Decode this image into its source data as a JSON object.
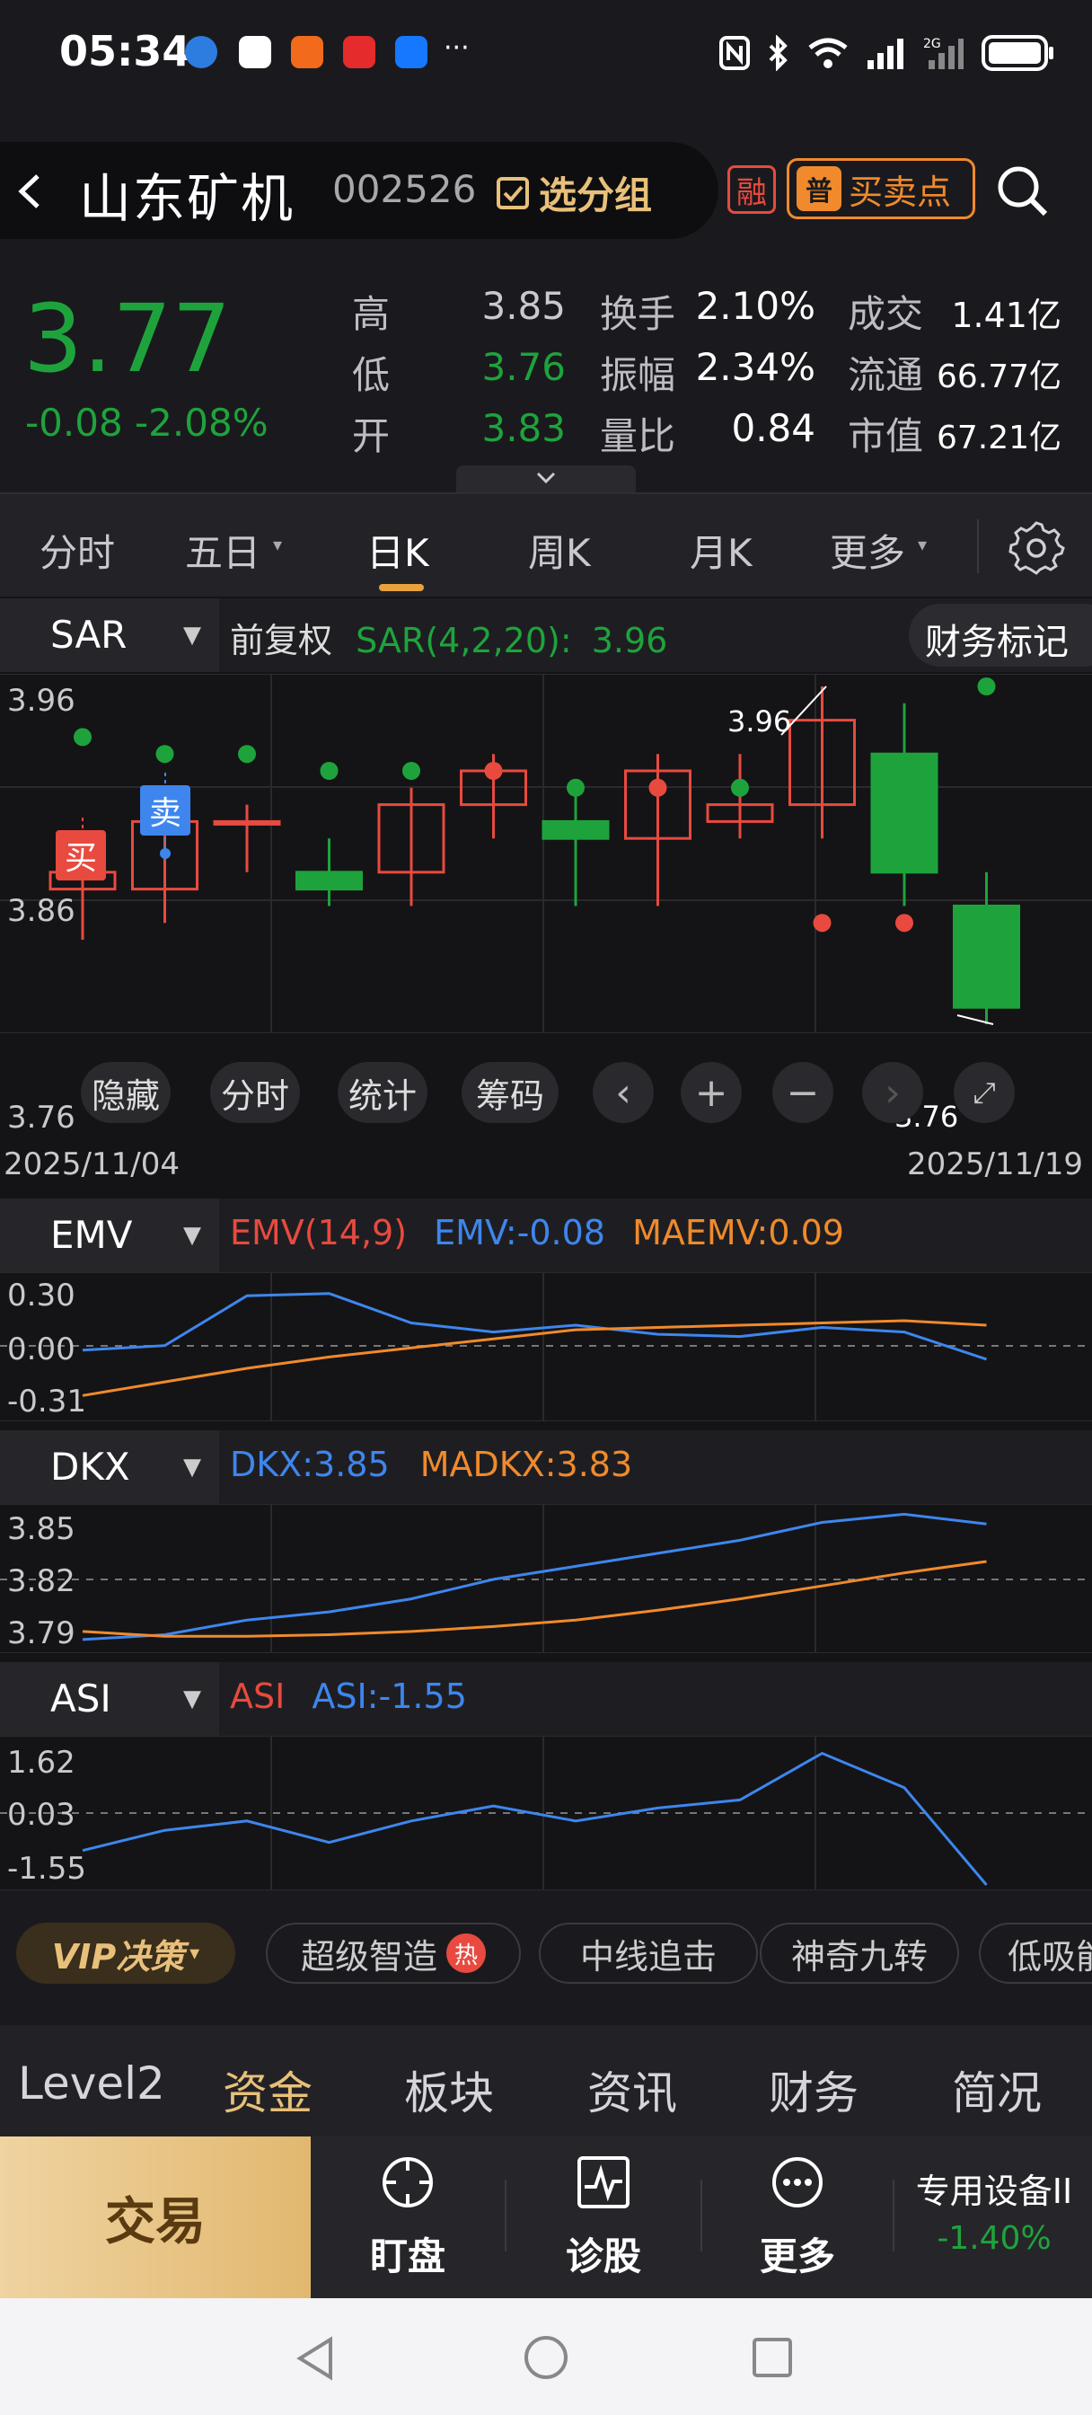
{
  "status": {
    "time": "05:34",
    "ellipsis": "···"
  },
  "header": {
    "name": "山东矿机",
    "code": "002526",
    "group_label": "选分组",
    "rong_badge": "融",
    "bs_icon": "普",
    "bs_label": "买卖点"
  },
  "quote": {
    "price": "3.77",
    "change": "-0.08  -2.08%",
    "rows": [
      {
        "l1": "高",
        "v1": "3.85",
        "l2": "换手",
        "v2": "2.10%",
        "l3": "成交",
        "v3": "1.41亿"
      },
      {
        "l1": "低",
        "v1": "3.76",
        "l2": "振幅",
        "v2": "2.34%",
        "l3": "流通",
        "v3": "66.77亿"
      },
      {
        "l1": "开",
        "v1": "3.83",
        "l2": "量比",
        "v2": "0.84",
        "l3": "市值",
        "v3": "67.21亿"
      }
    ]
  },
  "tabs": [
    "分时",
    "五日",
    "日K",
    "周K",
    "月K",
    "更多"
  ],
  "sar": {
    "selector": "SAR",
    "mode": "前复权",
    "label": "SAR(4,2,20):",
    "value": "3.96",
    "fin_mark": "财务标记",
    "y_top": "3.96",
    "y_mid": "3.86",
    "y_bot": "3.76",
    "date_start": "2025/11/04",
    "date_end": "2025/11/19",
    "high_mark": "3.96",
    "low_mark": "3.76",
    "buy": "买",
    "sell": "卖"
  },
  "tools": [
    "隐藏",
    "分时",
    "统计",
    "筹码"
  ],
  "emv": {
    "selector": "EMV",
    "label": "EMV(14,9)",
    "emv": "EMV:-0.08",
    "maemv": "MAEMV:0.09",
    "y_top": "0.30",
    "y_mid": "0.00",
    "y_bot": "-0.31"
  },
  "dkx": {
    "selector": "DKX",
    "dkx": "DKX:3.85",
    "madkx": "MADKX:3.83",
    "y_top": "3.85",
    "y_mid": "3.82",
    "y_bot": "3.79"
  },
  "asi": {
    "selector": "ASI",
    "label": "ASI",
    "asi": "ASI:-1.55",
    "y_top": "1.62",
    "y_mid": "0.03",
    "y_bot": "-1.55"
  },
  "chips": {
    "vip": "VIP决策",
    "items": [
      "超级智造",
      "中线追击",
      "神奇九转",
      "低吸能"
    ],
    "hot": "热"
  },
  "info_tabs": [
    "Level2",
    "资金",
    "板块",
    "资讯",
    "财务",
    "简况"
  ],
  "bottom": {
    "trade": "交易",
    "items": [
      "盯盘",
      "诊股",
      "更多"
    ],
    "sector_name": "专用设备II",
    "sector_change": "-1.40%"
  },
  "colors": {
    "up": "#e84a3f",
    "down": "#1ea33c",
    "blue": "#3e86ee",
    "orange": "#f08a2c",
    "gold": "#e8c07a"
  },
  "chart_data": [
    {
      "type": "candlestick",
      "title": "SAR(4,2,20)",
      "x": [
        "2025/11/04",
        "",
        "",
        "",
        "",
        "",
        "",
        "",
        "",
        "",
        "",
        "2025/11/19"
      ],
      "open": [
        3.84,
        3.84,
        3.88,
        3.85,
        3.85,
        3.89,
        3.88,
        3.87,
        3.88,
        3.89,
        3.92,
        3.83
      ],
      "close": [
        3.85,
        3.88,
        3.88,
        3.84,
        3.89,
        3.91,
        3.87,
        3.91,
        3.89,
        3.94,
        3.85,
        3.77
      ],
      "high": [
        3.86,
        3.89,
        3.89,
        3.87,
        3.9,
        3.92,
        3.9,
        3.92,
        3.92,
        3.96,
        3.95,
        3.85
      ],
      "low": [
        3.81,
        3.82,
        3.85,
        3.83,
        3.83,
        3.87,
        3.83,
        3.83,
        3.87,
        3.87,
        3.83,
        3.76
      ],
      "sar": [
        3.93,
        3.92,
        3.92,
        3.91,
        3.91,
        3.91,
        3.9,
        3.9,
        3.9,
        3.82,
        3.82,
        3.96
      ],
      "ylim": [
        3.76,
        3.96
      ]
    },
    {
      "type": "line",
      "title": "EMV(14,9)",
      "series": [
        {
          "name": "EMV",
          "values": [
            -0.02,
            0.0,
            0.22,
            0.23,
            0.1,
            0.06,
            0.09,
            0.05,
            0.04,
            0.08,
            0.06,
            -0.06
          ]
        },
        {
          "name": "MAEMV",
          "values": [
            -0.22,
            -0.16,
            -0.1,
            -0.05,
            -0.01,
            0.03,
            0.07,
            0.08,
            0.09,
            0.1,
            0.11,
            0.09
          ]
        }
      ],
      "ylim": [
        -0.31,
        0.3
      ]
    },
    {
      "type": "line",
      "title": "DKX",
      "series": [
        {
          "name": "DKX",
          "values": [
            3.785,
            3.788,
            3.797,
            3.802,
            3.81,
            3.822,
            3.83,
            3.838,
            3.846,
            3.857,
            3.862,
            3.856
          ]
        },
        {
          "name": "MADKX",
          "values": [
            3.79,
            3.787,
            3.787,
            3.788,
            3.79,
            3.793,
            3.797,
            3.803,
            3.81,
            3.818,
            3.826,
            3.833
          ]
        }
      ],
      "ylim": [
        3.78,
        3.865
      ]
    },
    {
      "type": "line",
      "title": "ASI",
      "series": [
        {
          "name": "ASI",
          "values": [
            -0.7,
            -0.2,
            0.03,
            -0.5,
            0.03,
            0.4,
            0.03,
            0.35,
            0.55,
            1.7,
            0.85,
            -1.55
          ]
        }
      ],
      "ylim": [
        -1.55,
        2.0
      ]
    }
  ]
}
